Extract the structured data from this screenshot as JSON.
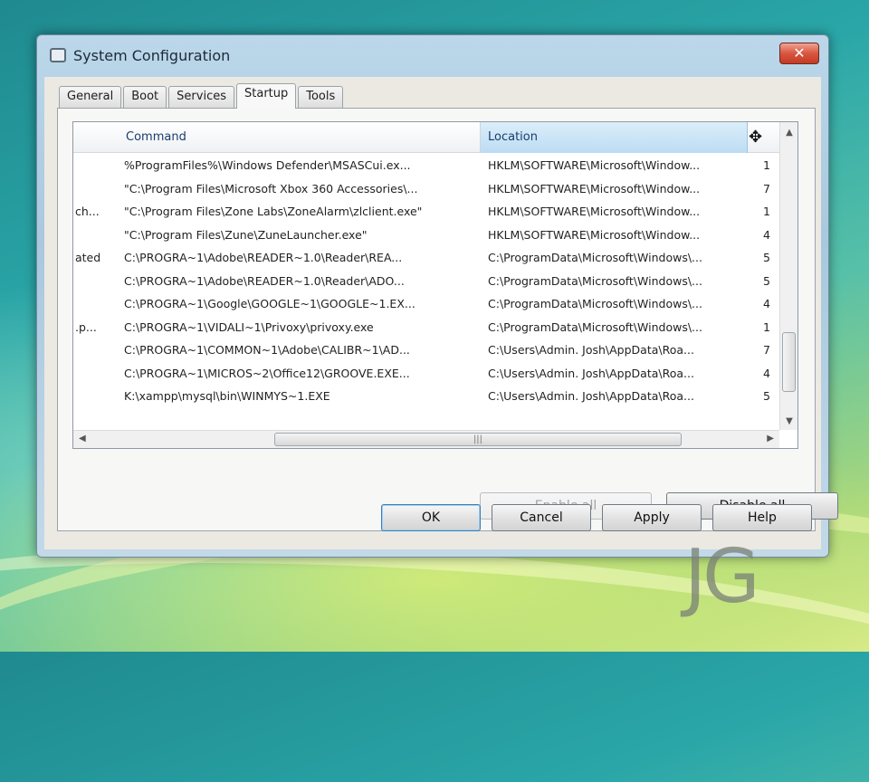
{
  "window": {
    "title": "System Configuration",
    "close_label": "✕"
  },
  "tabs": [
    {
      "label": "General"
    },
    {
      "label": "Boot"
    },
    {
      "label": "Services"
    },
    {
      "label": "Startup"
    },
    {
      "label": "Tools"
    }
  ],
  "active_tab": "Startup",
  "grid": {
    "columns": [
      "Command",
      "Location"
    ],
    "rows": [
      {
        "item": "",
        "command": "%ProgramFiles%\\Windows Defender\\MSASCui.ex...",
        "location": "HKLM\\SOFTWARE\\Microsoft\\Window...",
        "date": "1"
      },
      {
        "item": "",
        "command": "\"C:\\Program Files\\Microsoft Xbox 360 Accessories\\...",
        "location": "HKLM\\SOFTWARE\\Microsoft\\Window...",
        "date": "7"
      },
      {
        "item": "ch...",
        "command": "\"C:\\Program Files\\Zone Labs\\ZoneAlarm\\zlclient.exe\"",
        "location": "HKLM\\SOFTWARE\\Microsoft\\Window...",
        "date": "1"
      },
      {
        "item": "",
        "command": "\"C:\\Program Files\\Zune\\ZuneLauncher.exe\"",
        "location": "HKLM\\SOFTWARE\\Microsoft\\Window...",
        "date": "4"
      },
      {
        "item": "ated",
        "command": "C:\\PROGRA~1\\Adobe\\READER~1.0\\Reader\\REA...",
        "location": "C:\\ProgramData\\Microsoft\\Windows\\...",
        "date": "5"
      },
      {
        "item": "",
        "command": "C:\\PROGRA~1\\Adobe\\READER~1.0\\Reader\\ADO...",
        "location": "C:\\ProgramData\\Microsoft\\Windows\\...",
        "date": "5"
      },
      {
        "item": "",
        "command": "C:\\PROGRA~1\\Google\\GOOGLE~1\\GOOGLE~1.EX...",
        "location": "C:\\ProgramData\\Microsoft\\Windows\\...",
        "date": "4"
      },
      {
        "item": ".p...",
        "command": "C:\\PROGRA~1\\VIDALI~1\\Privoxy\\privoxy.exe",
        "location": "C:\\ProgramData\\Microsoft\\Windows\\...",
        "date": "1"
      },
      {
        "item": "",
        "command": "C:\\PROGRA~1\\COMMON~1\\Adobe\\CALIBR~1\\AD...",
        "location": "C:\\Users\\Admin. Josh\\AppData\\Roa...",
        "date": "7"
      },
      {
        "item": "",
        "command": "C:\\PROGRA~1\\MICROS~2\\Office12\\GROOVE.EXE...",
        "location": "C:\\Users\\Admin. Josh\\AppData\\Roa...",
        "date": "4"
      },
      {
        "item": "",
        "command": "K:\\xampp\\mysql\\bin\\WINMYS~1.EXE",
        "location": "C:\\Users\\Admin. Josh\\AppData\\Roa...",
        "date": "5"
      }
    ]
  },
  "buttons": {
    "enable_all": "Enable all",
    "disable_all": "Disable all",
    "ok": "OK",
    "cancel": "Cancel",
    "apply": "Apply",
    "help": "Help"
  },
  "watermark": "JG",
  "colors": {
    "selected_header": "#bcdcf3",
    "close_button": "#d9553f"
  }
}
